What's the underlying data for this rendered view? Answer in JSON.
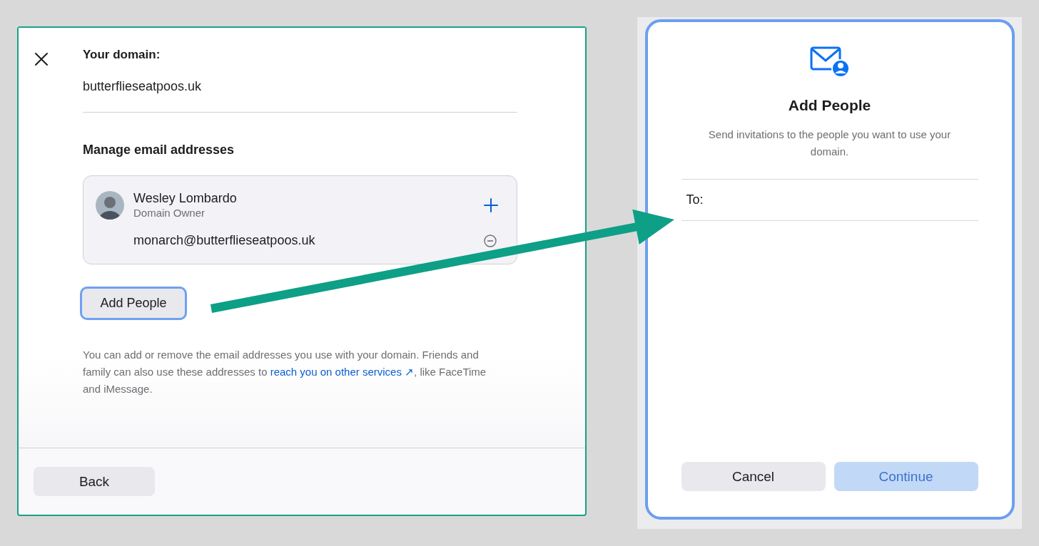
{
  "left_dialog": {
    "domain_label": "Your domain:",
    "domain": "butterflieseatpoos.uk",
    "section_title": "Manage email addresses",
    "owner": {
      "name": "Wesley Lombardo",
      "role": "Domain Owner",
      "addresses": [
        "monarch@butterflieseatpoos.uk"
      ]
    },
    "add_button": {
      "label": "Add People",
      "focused": true
    },
    "note": {
      "before": "You can add or remove the email addresses you use with your domain. Friends and family can also use these addresses to ",
      "link": "reach you on other services ↗",
      "after": ", like FaceTime and iMessage."
    },
    "back_button": "Back"
  },
  "right_dialog": {
    "title": "Add People",
    "description": "Send invitations to the people you want to use your domain.",
    "to_label": "To:",
    "cancel_button": "Cancel",
    "continue_button": {
      "label": "Continue",
      "disabled": true
    }
  }
}
